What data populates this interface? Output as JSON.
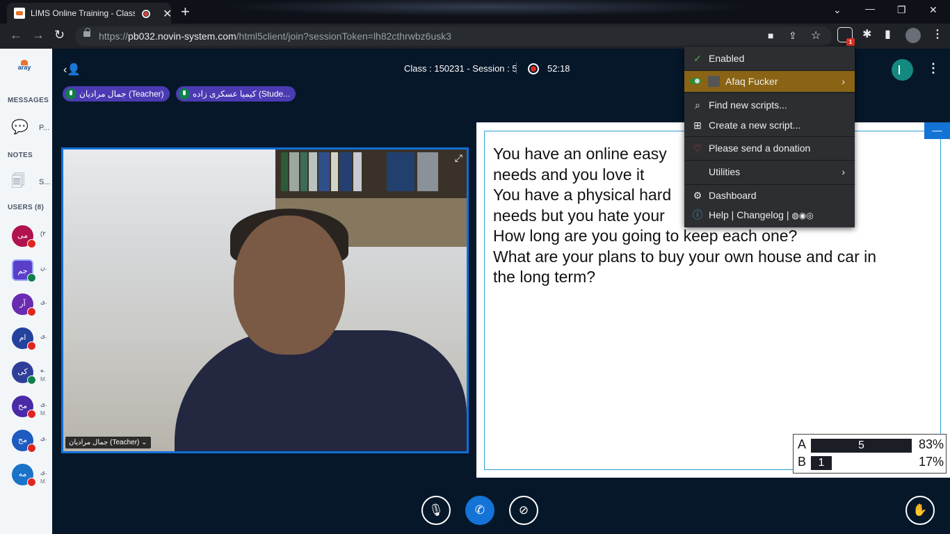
{
  "browser": {
    "tab_title": "LIMS Online Training - Class",
    "url_host": "pb032.novin-system.com",
    "url_scheme": "https://",
    "url_path": "/html5client/join?sessionToken=lh82cthrwbz6usk3",
    "extension_badge": "1"
  },
  "sidebar": {
    "logo_text": "aray",
    "messages_title": "MESSAGES",
    "messages_item": "P...",
    "notes_title": "NOTES",
    "notes_item": "S...",
    "users_title": "USERS (8)",
    "users": [
      {
        "initials": "می",
        "name": "(۲",
        "meta": "",
        "color": "#b0134d",
        "status": "red",
        "shape": "circle"
      },
      {
        "initials": "جم",
        "name": "ن.",
        "meta": "",
        "color": "#5b3fc9",
        "status": "green",
        "shape": "square"
      },
      {
        "initials": "آر",
        "name": "ی.",
        "meta": "",
        "color": "#6a2bb3",
        "status": "red",
        "shape": "circle"
      },
      {
        "initials": "ام",
        "name": "ی.",
        "meta": "",
        "color": "#24429e",
        "status": "red",
        "shape": "circle"
      },
      {
        "initials": "کی",
        "name": "ه.",
        "meta": "M.",
        "color": "#2e3f9a",
        "status": "green",
        "shape": "circle"
      },
      {
        "initials": "مح",
        "name": "ی.",
        "meta": "M.",
        "color": "#4a2aa6",
        "status": "red",
        "shape": "circle"
      },
      {
        "initials": "مح",
        "name": "ی.",
        "meta": "",
        "color": "#1d5bc0",
        "status": "red",
        "shape": "circle"
      },
      {
        "initials": "مه",
        "name": "ی.",
        "meta": "M.",
        "color": "#1a72c9",
        "status": "red",
        "shape": "circle"
      }
    ]
  },
  "header": {
    "session_info": "Class : 150231 - Session : 5",
    "rec_time": "52:18"
  },
  "talkers": [
    {
      "label": "جمال مرادیان (Teacher)"
    },
    {
      "label": "کیمیا عسکری زاده (Stude..."
    }
  ],
  "video": {
    "label": "جمال مرادیان (Teacher) ⌄"
  },
  "slide": {
    "lines": [
      "You have an online easy                            our",
      "needs and you love it",
      "You have a physical hard                      eeds your",
      "needs but you hate your",
      "How long are you going to keep each one?",
      "What are your plans to buy your own house and car in",
      "the long term?"
    ]
  },
  "poll": {
    "rows": [
      {
        "option": "A",
        "votes": "5",
        "percent": "83%",
        "fraction": 0.83
      },
      {
        "option": "B",
        "votes": "1",
        "percent": "17%",
        "fraction": 0.17
      }
    ]
  },
  "menu": {
    "enabled": "Enabled",
    "script_name": "Afaq Fucker",
    "find": "Find new scripts...",
    "create": "Create a new script...",
    "donate": "Please send a donation",
    "utilities": "Utilities",
    "dashboard": "Dashboard",
    "help": "Help | Changelog |"
  },
  "icons": {
    "check": "check-icon",
    "search": "search-icon",
    "plus": "plus-square-icon",
    "heart": "heart-icon",
    "gear": "gear-icon",
    "info": "info-icon"
  },
  "colors": {
    "accent_blue": "#1473d6",
    "menu_selected": "#8a6414",
    "connection": "#14897f",
    "record_red": "#df2721"
  }
}
